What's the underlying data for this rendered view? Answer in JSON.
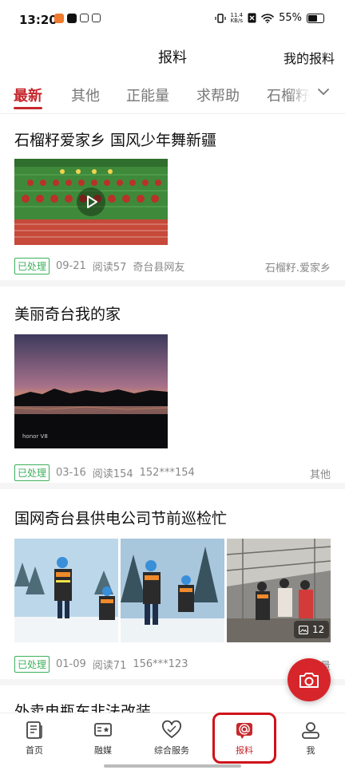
{
  "status_bar": {
    "time": "13:20",
    "speed_value": "11.4",
    "speed_unit": "KB/s",
    "battery": "55%"
  },
  "header": {
    "title": "报料",
    "my_reports": "我的报料"
  },
  "tabs": [
    {
      "label": "最新",
      "active": true
    },
    {
      "label": "其他"
    },
    {
      "label": "正能量"
    },
    {
      "label": "求帮助"
    },
    {
      "label": "石榴籽"
    }
  ],
  "posts": [
    {
      "title": "石榴籽爱家乡 国风少年舞新疆",
      "status": "已处理",
      "date": "09-21",
      "reads": "阅读57",
      "author": "奇台县网友",
      "category": "石榴籽.爱家乡",
      "media": "video"
    },
    {
      "title": "美丽奇台我的家",
      "status": "已处理",
      "date": "03-16",
      "reads": "阅读154",
      "author": "152***154",
      "category": "其他",
      "media": "photo",
      "watermark": "honor V8"
    },
    {
      "title": "国网奇台县供电公司节前巡检忙",
      "status": "已处理",
      "date": "01-09",
      "reads": "阅读71",
      "author": "156***123",
      "category": "正能量",
      "media": "gallery",
      "image_count": "12"
    },
    {
      "title": "外卖电瓶车非法改装"
    }
  ],
  "bottom_nav": [
    {
      "label": "首页",
      "icon": "news-icon"
    },
    {
      "label": "融媒",
      "icon": "media-icon"
    },
    {
      "label": "综合服务",
      "icon": "heart-service-icon"
    },
    {
      "label": "报料",
      "icon": "report-icon",
      "active": true
    },
    {
      "label": "我",
      "icon": "person-icon"
    }
  ],
  "colors": {
    "accent": "#c6282d",
    "badge": "#3cb05a",
    "fab": "#d7262b"
  }
}
